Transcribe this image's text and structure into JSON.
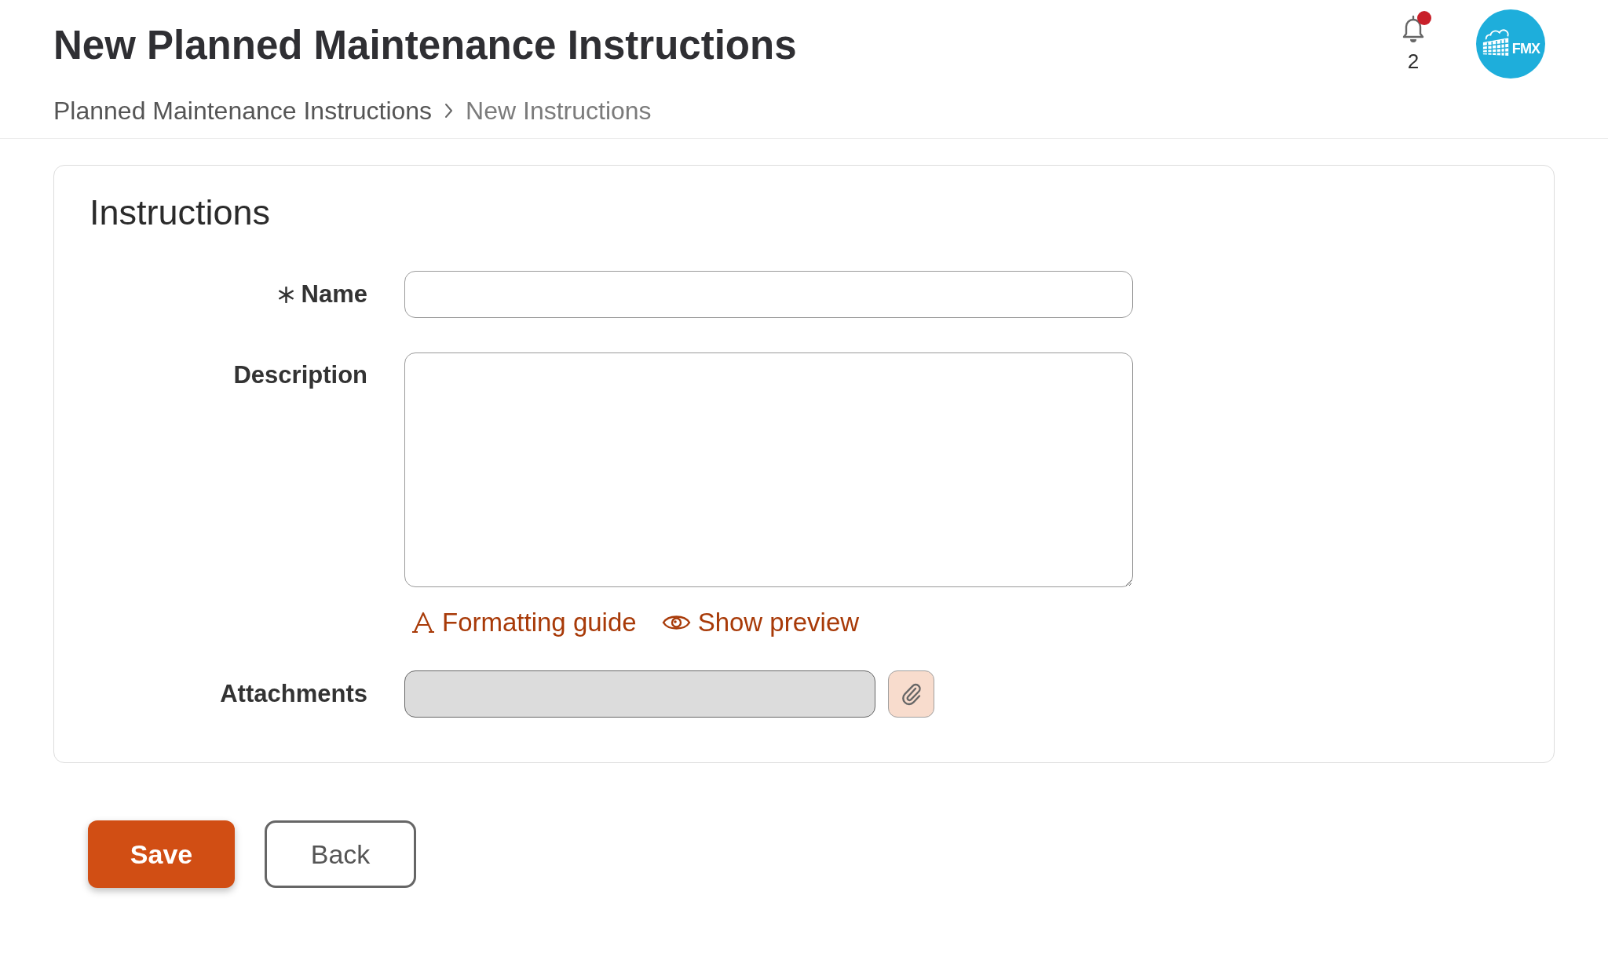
{
  "header": {
    "title": "New Planned Maintenance Instructions",
    "breadcrumb": [
      {
        "label": "Planned Maintenance Instructions",
        "current": false
      },
      {
        "label": "New Instructions",
        "current": true
      }
    ],
    "notifications": {
      "count": "2",
      "unread": true
    },
    "logo": {
      "text": "FMX"
    }
  },
  "form": {
    "title": "Instructions",
    "fields": [
      {
        "kind": "text",
        "label": "Name",
        "required": true,
        "disabled": false
      },
      {
        "kind": "textarea",
        "label": "Description",
        "required": false,
        "disabled": false,
        "links": [
          {
            "kind": "formatting",
            "label": "Formatting guide"
          },
          {
            "kind": "preview",
            "label": "Show preview"
          }
        ]
      },
      {
        "kind": "file",
        "label": "Attachments",
        "required": false,
        "disabled": true
      }
    ]
  },
  "buttons": [
    {
      "kind": "primary",
      "label": "Save"
    },
    {
      "kind": "secondary",
      "label": "Back"
    }
  ]
}
